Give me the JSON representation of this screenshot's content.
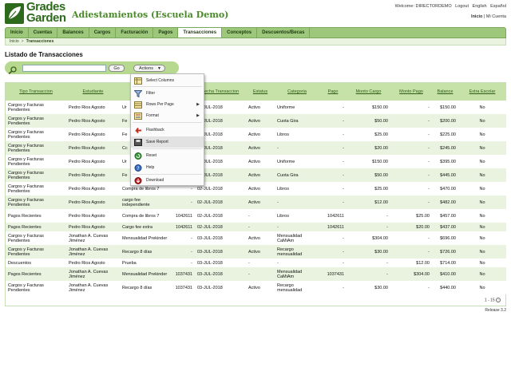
{
  "header": {
    "logo_line1": "Grades",
    "logo_line2": "Garden",
    "app_title": "Adiestamientos (Escuela Demo)",
    "welcome": "Welcome: DIRECTORDEMO",
    "logout": "Logout",
    "lang_en": "English",
    "lang_es": "Español",
    "home": "Inicio",
    "my_account": "Mi Cuenta"
  },
  "nav": {
    "items": [
      {
        "label": "Inicio"
      },
      {
        "label": "Cuentas"
      },
      {
        "label": "Balances"
      },
      {
        "label": "Cargos"
      },
      {
        "label": "Facturación"
      },
      {
        "label": "Pagos"
      },
      {
        "label": "Transacciones",
        "active": true
      },
      {
        "label": "Conceptos"
      },
      {
        "label": "Descuentos/Becas"
      }
    ]
  },
  "breadcrumb": {
    "home": "Inicio",
    "current": "Transacciones"
  },
  "page_title": "Listado de Transacciones",
  "search": {
    "value": "",
    "go_label": "Go",
    "actions_label": "Actions"
  },
  "menu": {
    "items": [
      {
        "label": "Select Columns",
        "icon": "select-columns-icon"
      },
      {
        "label": "Filter",
        "icon": "filter-icon"
      },
      {
        "label": "Rows Per Page",
        "icon": "rows-per-page-icon",
        "submenu": true
      },
      {
        "label": "Format",
        "icon": "format-icon",
        "submenu": true
      },
      {
        "label": "Flashback",
        "icon": "flashback-icon"
      },
      {
        "label": "Save Report",
        "icon": "save-icon",
        "highlighted": true
      },
      {
        "label": "Reset",
        "icon": "reset-icon"
      },
      {
        "label": "Help",
        "icon": "help-icon"
      },
      {
        "label": "Download",
        "icon": "download-icon"
      }
    ]
  },
  "table": {
    "columns": [
      "Tipo Transaccion",
      "Estudiante",
      "",
      "",
      "Fecha Transaccion",
      "Estatus",
      "Categoria",
      "Pago",
      "Monto Cargo",
      "Monto Pago",
      "Balance",
      "Extra Escolar"
    ],
    "rows": [
      [
        "Cargos y Facturas Pendientes",
        "Pedro Rios Agosto",
        "Ur",
        "",
        "02-JUL-2018",
        "Activo",
        "Uniforme",
        "-",
        "$150.00",
        "-",
        "$150.00",
        "No"
      ],
      [
        "Cargos y Facturas Pendientes",
        "Pedro Rios Agosto",
        "Fe",
        "",
        "02-JUL-2018",
        "Activo",
        "Cuota Gira",
        "-",
        "$50.00",
        "-",
        "$200.00",
        "No"
      ],
      [
        "Cargos y Facturas Pendientes",
        "Pedro Rios Agosto",
        "Fe",
        "",
        "02-JUL-2018",
        "Activo",
        "Libros",
        "-",
        "$25.00",
        "-",
        "$225.00",
        "No"
      ],
      [
        "Cargos y Facturas Pendientes",
        "Pedro Rios Agosto",
        "Cc",
        "",
        "02-JUL-2018",
        "Activo",
        "-",
        "-",
        "$20.00",
        "-",
        "$245.00",
        "No"
      ],
      [
        "Cargos y Facturas Pendientes",
        "Pedro Rios Agosto",
        "Ur",
        "",
        "02-JUL-2018",
        "Activo",
        "Uniforme",
        "-",
        "$150.00",
        "-",
        "$395.00",
        "No"
      ],
      [
        "Cargos y Facturas Pendientes",
        "Pedro Rios Agosto",
        "Fe",
        "",
        "02-JUL-2018",
        "Activo",
        "Cuota Gira",
        "-",
        "$50.00",
        "-",
        "$445.00",
        "No"
      ],
      [
        "Cargos y Facturas Pendientes",
        "Pedro Rios Agosto",
        "Compra de libros 7",
        "-",
        "02-JUL-2018",
        "Activo",
        "Libros",
        "-",
        "$25.00",
        "-",
        "$470.00",
        "No"
      ],
      [
        "Cargos y Facturas Pendientes",
        "Pedro Rios Agosto",
        "cargo fee independiente",
        "-",
        "02-JUL-2018",
        "Activo",
        "-",
        "-",
        "$12.00",
        "-",
        "$482.00",
        "No"
      ],
      [
        "Pagos Recientes",
        "Pedro Rios Agosto",
        "Compra de libros 7",
        "1042611",
        "02-JUL-2018",
        "-",
        "Libros",
        "1042611",
        "-",
        "$25.00",
        "$457.00",
        "No"
      ],
      [
        "Pagos Recientes",
        "Pedro Rios Agosto",
        "Cargo fee extra",
        "1042611",
        "02-JUL-2018",
        "-",
        "-",
        "1042611",
        "-",
        "$20.00",
        "$437.00",
        "No"
      ],
      [
        "Cargos y Facturas Pendientes",
        "Jonathan A. Cuevas Jiménez",
        "Mensualidad Prekinder",
        "-",
        "03-JUL-2018",
        "Activo",
        "Mensualidad CaMiAm",
        "-",
        "$304.00",
        "-",
        "$696.00",
        "No"
      ],
      [
        "Cargos y Facturas Pendientes",
        "Jonathan A. Cuevas Jiménez",
        "Recargo 8 días",
        "-",
        "03-JUL-2018",
        "Activo",
        "Recargo mensualidad",
        "-",
        "$30.00",
        "-",
        "$726.00",
        "No"
      ],
      [
        "Descuentos",
        "Pedro Rios Agosto",
        "Prueba",
        "-",
        "03-JUL-2018",
        "-",
        "-",
        "-",
        "-",
        "$12.00",
        "$714.00",
        "No"
      ],
      [
        "Pagos Recientes",
        "Jonathan A. Cuevas Jiménez",
        "Mensualidad Prekinder",
        "1037431",
        "03-JUL-2018",
        "-",
        "Mensualidad CaMiAm",
        "1037431",
        "-",
        "$304.00",
        "$410.00",
        "No"
      ],
      [
        "Cargos y Facturas Pendientes",
        "Jonathan A. Cuevas Jiménez",
        "Recargo 8 días",
        "1037431",
        "03-JUL-2018",
        "Activo",
        "Recargo mensualidad",
        "-",
        "$30.00",
        "-",
        "$440.00",
        "No"
      ]
    ],
    "pagination": "1 - 15"
  },
  "release": "Release 3.2",
  "colors": {
    "nav_bg": "#9dc77b",
    "header_row": "#c7e2a8",
    "row_alt": "#e9f3df",
    "brand": "#2d6a1c"
  }
}
